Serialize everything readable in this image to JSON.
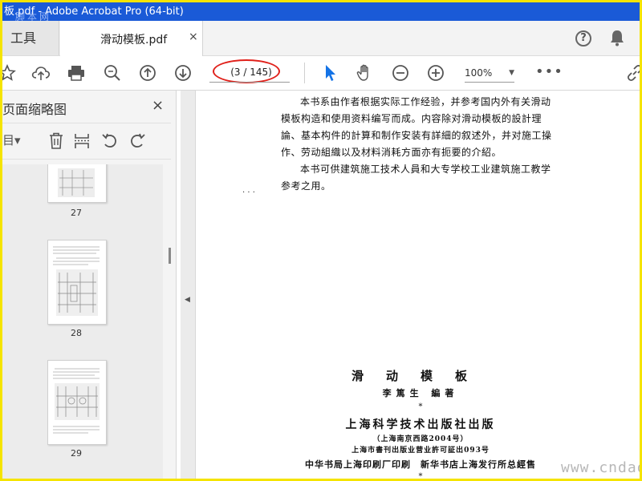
{
  "window": {
    "title": "板.pdf - Adobe Acrobat Pro (64-bit)",
    "watermark_top": "脚本网"
  },
  "tabs": {
    "tools_label": "工具",
    "document_tab": "滑动模板.pdf",
    "close_glyph": "×"
  },
  "toolbar": {
    "page_indicator": "(3 / 145)",
    "zoom_value": "100%",
    "more_glyph": "•••"
  },
  "panel": {
    "title": "页面缩略图",
    "close_glyph": "×",
    "options_glyph": "目▾",
    "thumbnails": [
      {
        "label": "27"
      },
      {
        "label": "28"
      },
      {
        "label": "29"
      }
    ]
  },
  "document": {
    "paragraph1": "本书系由作者根据实际工作经验，并参考国内外有关滑动模板构造和使用资料编写而成。内容除对滑动模板的設計理論、基本构件的計算和制作安装有詳細的叙述外，并对施工操作、劳动組織以及材料消耗方面亦有扼要的介紹。",
    "paragraph2": "本书可供建筑施工技术人員和大专学校工业建筑施工教学参考之用。",
    "book_title": "滑动模板",
    "author": "李篤生 編著",
    "star": "*",
    "publisher": "上海科学技术出版社出版",
    "address": "（上海南京西路2004号）",
    "license": "上海市書刊出版业营业許可証出093号",
    "printer": "中华书局上海印刷厂印刷　新华书店上海发行所总經售",
    "star2": "*"
  },
  "watermark": "www.cndao.com",
  "colors": {
    "titlebar": "#1a5ad7",
    "frame_border": "#f5e400",
    "annotation_ellipse": "#e0201a",
    "accent_cursor": "#1473e6"
  }
}
